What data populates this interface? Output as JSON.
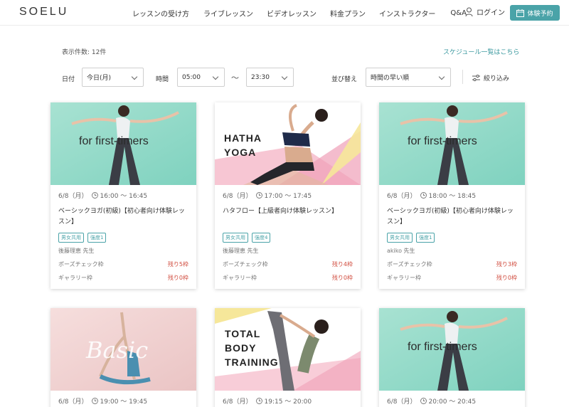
{
  "header": {
    "logo": "SOELU",
    "nav": [
      "レッスンの受け方",
      "ライブレッスン",
      "ビデオレッスン",
      "料金プラン",
      "インストラクター",
      "Q&A"
    ],
    "login": "ログイン",
    "trial": "体験予約",
    "accent": "#4aa3a8"
  },
  "filters": {
    "count": "表示件数: 12件",
    "schedule_link": "スケジュール一覧はこちら",
    "date_label": "日付",
    "date_value": "今日(月)",
    "time_label": "時間",
    "time_from": "05:00",
    "tilde": "〜",
    "time_to": "23:30",
    "sort_label": "並び替え",
    "sort_value": "時間の早い順",
    "filter": "絞り込み"
  },
  "cards": [
    {
      "date": "6/8（月）",
      "time": "16:00 〜 16:45",
      "image_title": "for first-timers",
      "title": "ベーシックヨガ(初級)【初心者向け体験レッスン】",
      "tags": [
        "男女共用",
        "強度1"
      ],
      "teacher": "後藤理恵 先生",
      "pose_label": "ポーズチェック枠",
      "pose_remain": "残り5枠",
      "gallery_label": "ギャラリー枠",
      "gallery_remain": "残り0枠"
    },
    {
      "date": "6/8（月）",
      "time": "17:00 〜 17:45",
      "image_title": "HATHA\nYOGA",
      "title": "ハタフロー【上級者向け体験レッスン】",
      "tags": [
        "男女共用",
        "強度4"
      ],
      "teacher": "後藤理恵 先生",
      "pose_label": "ポーズチェック枠",
      "pose_remain": "残り4枠",
      "gallery_label": "ギャラリー枠",
      "gallery_remain": "残り0枠"
    },
    {
      "date": "6/8（月）",
      "time": "18:00 〜 18:45",
      "image_title": "for first-timers",
      "title": "ベーシックヨガ(初級)【初心者向け体験レッスン】",
      "tags": [
        "男女共用",
        "強度1"
      ],
      "teacher": "akiko 先生",
      "pose_label": "ポーズチェック枠",
      "pose_remain": "残り3枠",
      "gallery_label": "ギャラリー枠",
      "gallery_remain": "残り0枠"
    },
    {
      "date": "6/8（月）",
      "time": "19:00 〜 19:45",
      "image_title": "Basic"
    },
    {
      "date": "6/8（月）",
      "time": "19:15 〜 20:00",
      "image_title": "TOTAL\nBODY\nTRAINING"
    },
    {
      "date": "6/8（月）",
      "time": "20:00 〜 20:45",
      "image_title": "for first-timers"
    }
  ]
}
